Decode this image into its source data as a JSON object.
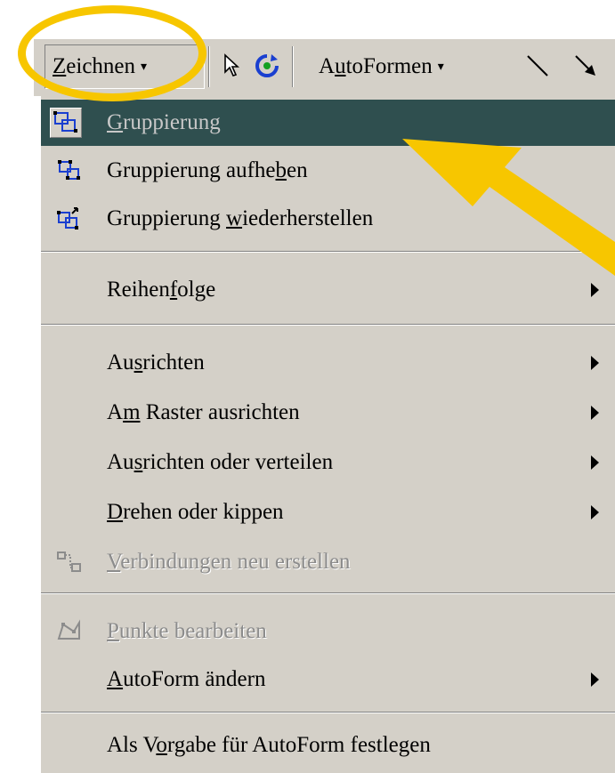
{
  "toolbar": {
    "zeichnen_label": "Zeichnen",
    "autoformen_label": "AutoFormen",
    "dropdown_glyph": "▾"
  },
  "menu": {
    "gruppierung": "Gruppierung",
    "gruppierung_aufheben": "Gruppierung aufheben",
    "gruppierung_wiederherstellen": "Gruppierung wiederherstellen",
    "reihenfolge": "Reihenfolge",
    "ausrichten": "Ausrichten",
    "am_raster": "Am Raster ausrichten",
    "ausrichten_verteilen": "Ausrichten oder verteilen",
    "drehen_kippen": "Drehen oder kippen",
    "verbindungen": "Verbindungen neu erstellen",
    "punkte": "Punkte bearbeiten",
    "autoform_aendern": "AutoForm ändern",
    "als_vorgabe": "Als Vorgabe für AutoForm festlegen"
  },
  "colors": {
    "highlight": "#2f4f4f",
    "menu_bg": "#d4d0c8",
    "annotation": "#f7c600"
  },
  "icons": [
    "select-arrow-icon",
    "free-rotate-icon",
    "line-icon",
    "arrow-icon",
    "group-icon",
    "ungroup-icon",
    "regroup-icon",
    "reroute-connectors-icon",
    "edit-points-icon"
  ]
}
